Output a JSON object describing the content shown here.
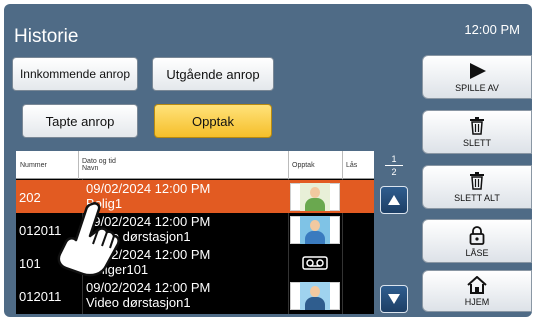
{
  "app": {
    "title": "Historie",
    "time": "12:00 PM"
  },
  "tabs": {
    "incoming": "Innkommende anrop",
    "outgoing": "Utgående anrop",
    "missed": "Tapte anrop",
    "recordings": "Opptak"
  },
  "table": {
    "headers": {
      "number": "Nummer",
      "date_line1": "Dato og tid",
      "date_line2": "Navn",
      "recording": "Opptak",
      "lock": "Lås"
    },
    "rows": [
      {
        "number": "202",
        "date": "09/02/2024 12:00 PM",
        "name": "Bolig1",
        "thumb": "camera-portrait-green",
        "selected": true
      },
      {
        "number": "012011",
        "date": "09/02/2024 12:00 PM",
        "name": "Video dørstasjon1",
        "thumb": "camera-portrait-blue",
        "selected": false
      },
      {
        "number": "101",
        "date": "09/02/2024 12:00 PM",
        "name": "Boliger101",
        "thumb": "voicemail-icon",
        "selected": false
      },
      {
        "number": "012011",
        "date": "09/02/2024 12:00 PM",
        "name": "Video dørstasjon1",
        "thumb": "camera-portrait-blue",
        "selected": false
      }
    ]
  },
  "pager": {
    "current": "1",
    "total": "2"
  },
  "side_buttons": {
    "play": "SPILLE AV",
    "delete": "SLETT",
    "delete_all": "SLETT ALT",
    "lock": "LÅSE",
    "home": "HJEM"
  },
  "colors": {
    "background": "#4f6b86",
    "selected_row": "#e25b22",
    "active_tab": "#f5bf2a"
  }
}
